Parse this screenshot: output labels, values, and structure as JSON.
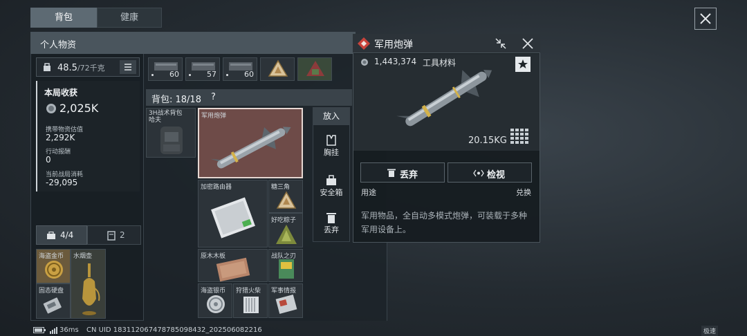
{
  "tabs": {
    "backpack": "背包",
    "health": "健康"
  },
  "left": {
    "title": "个人物资",
    "weight_current": "48.5",
    "weight_max": "/72千克",
    "earnings_title": "本局收获",
    "earnings_value": "2,025K",
    "carry_label": "携带物资估值",
    "carry_value": "2,292K",
    "reward_label": "行动报酬",
    "reward_value": "0",
    "cost_label": "当前战局消耗",
    "cost_value": "-29,095",
    "tab_a": "4/4",
    "tab_b": "2",
    "items": {
      "coin": "海盗金币",
      "vase": "水烟壶",
      "drive": "固态硬盘"
    }
  },
  "top_qty": [
    "60",
    "57",
    "60"
  ],
  "backpack": {
    "title": "背包: 18/18",
    "help": "?",
    "bag_label": "3H战术背包 哈夫",
    "selected": "军用炮弹",
    "router": "加密路由器",
    "triangle": "糖三角",
    "zongzi": "好吃粽子",
    "wood": "原木木板",
    "blade": "战队之刃",
    "silver": "海盗银币",
    "matches": "狩猎火柴",
    "intel": "军事情报"
  },
  "actions": {
    "put": "放入",
    "chest": "胸挂",
    "safe": "安全箱",
    "discard": "丢弃"
  },
  "detail": {
    "name": "军用炮弹",
    "price": "1,443,374",
    "category": "工具材料",
    "weight": "20.15KG",
    "discard_btn": "丢弃",
    "inspect_btn": "检视",
    "usage": "用途",
    "exchange": "兑换",
    "description": "军用物品，全自动多模式炮弹，可装载于多种军用设备上。"
  },
  "status": {
    "ping": "36ms",
    "uid": "CN UID 183112067478785098432_202506082216",
    "mode": "极速"
  }
}
